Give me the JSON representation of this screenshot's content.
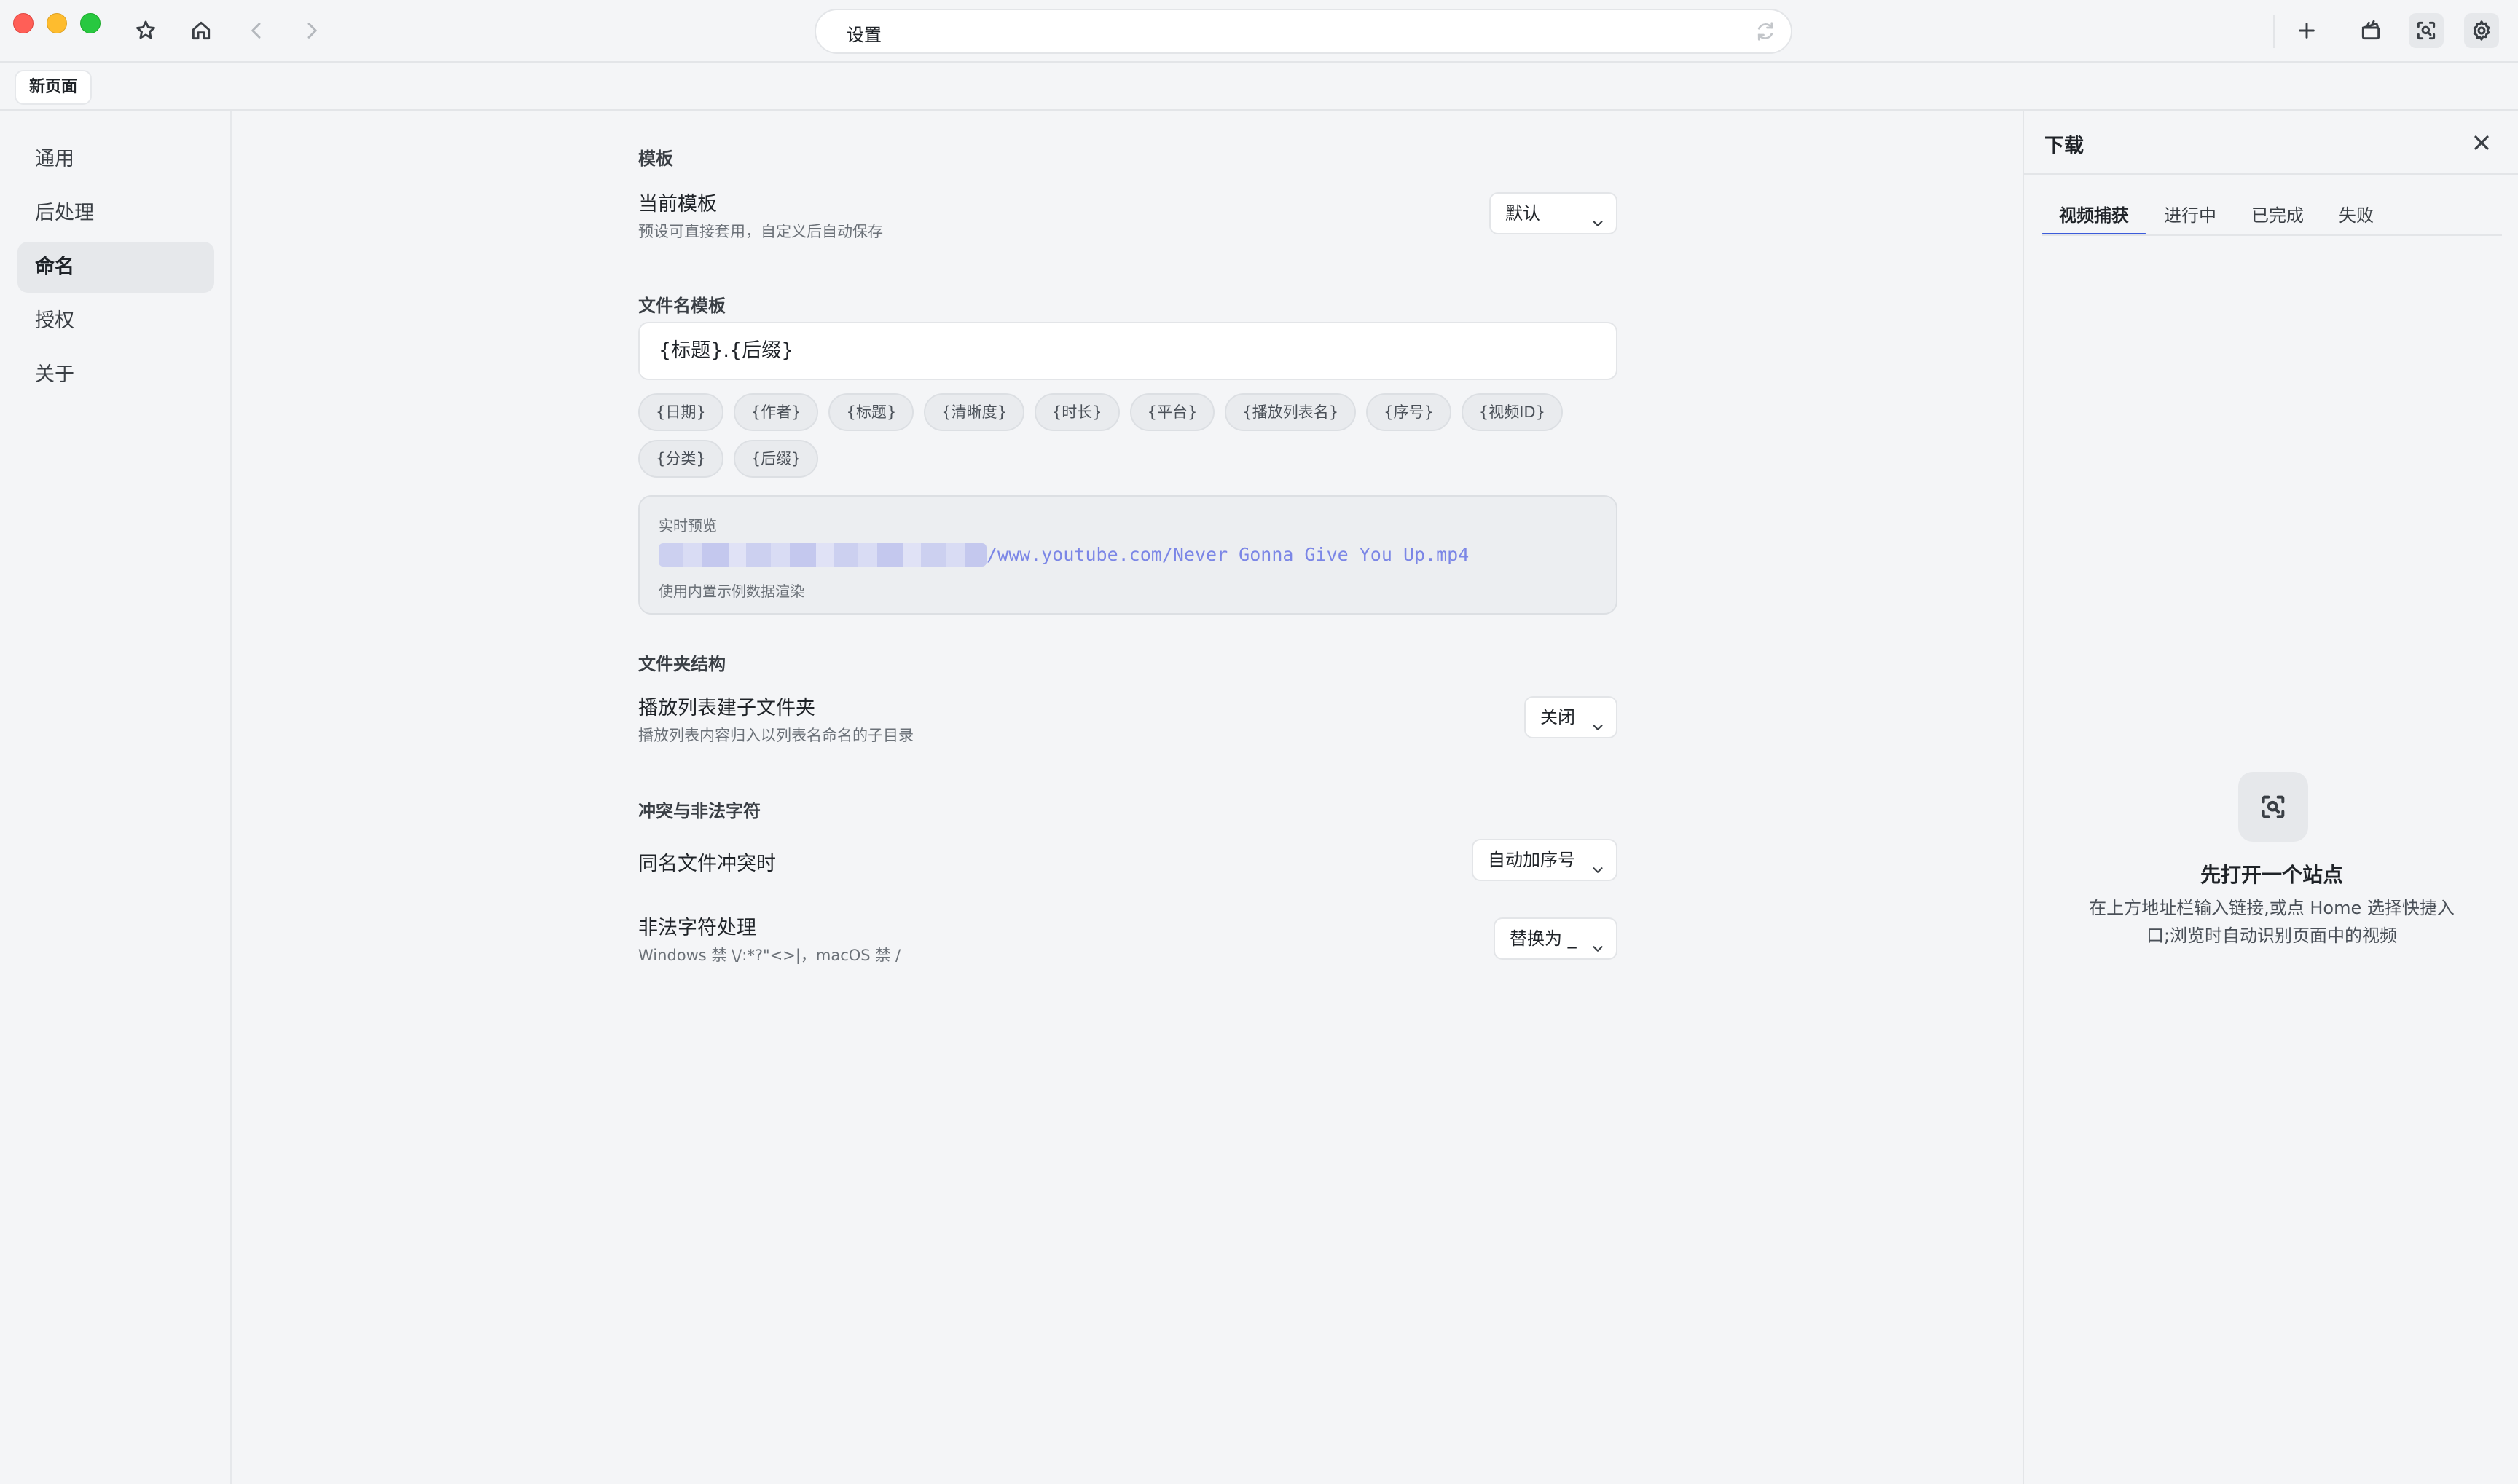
{
  "titlebar": {
    "address": "设置",
    "icons": [
      "star-icon",
      "home-icon",
      "back-icon",
      "forward-icon",
      "reload-icon",
      "plus-icon",
      "clapper-icon",
      "scan-icon",
      "gear-icon"
    ]
  },
  "tabs": {
    "current": "新页面"
  },
  "sidebar": {
    "items": [
      {
        "label": "通用"
      },
      {
        "label": "后处理"
      },
      {
        "label": "命名",
        "active": true
      },
      {
        "label": "授权"
      },
      {
        "label": "关于"
      }
    ]
  },
  "main": {
    "template": {
      "section": "模板",
      "label": "当前模板",
      "desc": "预设可直接套用，自定义后自动保存",
      "value": "默认"
    },
    "filename": {
      "section": "文件名模板",
      "value": "{标题}.{后缀}",
      "tokens_row1": [
        "{日期}",
        "{作者}",
        "{标题}",
        "{清晰度}",
        "{时长}",
        "{平台}",
        "{播放列表名}",
        "{序号}",
        "{视频ID}"
      ],
      "tokens_row2": [
        "{分类}",
        "{后缀}"
      ]
    },
    "preview": {
      "title": "实时预览",
      "path": "/www.youtube.com/Never Gonna Give You Up.mp4",
      "note": "使用内置示例数据渲染"
    },
    "folder": {
      "section": "文件夹结构",
      "label": "播放列表建子文件夹",
      "desc": "播放列表内容归入以列表名命名的子目录",
      "value": "关闭"
    },
    "conflict": {
      "section": "冲突与非法字符",
      "label": "同名文件冲突时",
      "value": "自动加序号"
    },
    "illegal": {
      "label": "非法字符处理",
      "desc": "Windows 禁 \\/:*?\"<>|，macOS 禁 /",
      "value": "替换为 _"
    }
  },
  "downloads": {
    "title": "下载",
    "tabs": [
      {
        "label": "视频捕获",
        "active": true
      },
      {
        "label": "进行中"
      },
      {
        "label": "已完成"
      },
      {
        "label": "失败"
      }
    ],
    "empty_title": "先打开一个站点",
    "empty_desc": "在上方地址栏输入链接,或点 Home 选择快捷入口;浏览时自动识别页面中的视频"
  },
  "colors": {
    "accent": "#3b5bdb",
    "preview_text": "#7b86e6"
  }
}
